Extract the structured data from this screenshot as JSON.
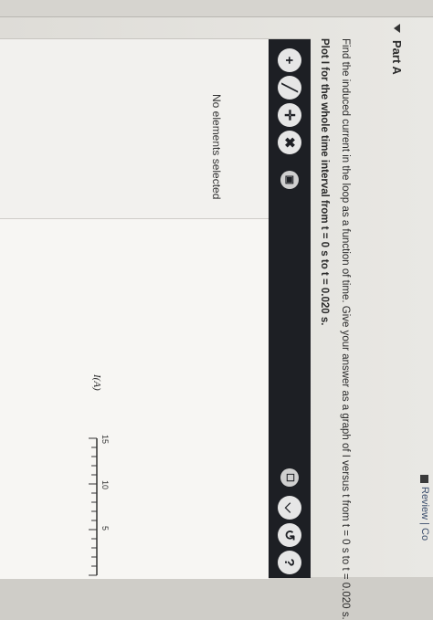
{
  "header": {
    "review_text": "Review | Co"
  },
  "part": {
    "title": "Part A",
    "prompt_line1": "Find the induced current in the loop as a function of time. Give your answer as a graph of I versus t from t = 0 s to t = 0.020 s.",
    "prompt_line2": "Plot I for the whole time interval from t = 0 s to t = 0.020 s."
  },
  "toolbar": {
    "buttons": [
      {
        "name": "add-point-button",
        "glyph": "+"
      },
      {
        "name": "line-tool-button",
        "glyph": "╱"
      },
      {
        "name": "move-tool-button",
        "glyph": "✛"
      },
      {
        "name": "delete-button",
        "glyph": "✖"
      },
      {
        "name": "trash-button",
        "glyph": "▣"
      }
    ],
    "right_buttons": [
      {
        "name": "hint-button",
        "glyph": "☐"
      },
      {
        "name": "expand-button",
        "glyph": "⌵"
      },
      {
        "name": "reset-button",
        "glyph": "↺"
      },
      {
        "name": "help-button",
        "glyph": "?"
      }
    ]
  },
  "status": "No elements selected",
  "graph": {
    "ylabel": "I(A)",
    "yticks": [
      "15",
      "10",
      "5"
    ]
  }
}
